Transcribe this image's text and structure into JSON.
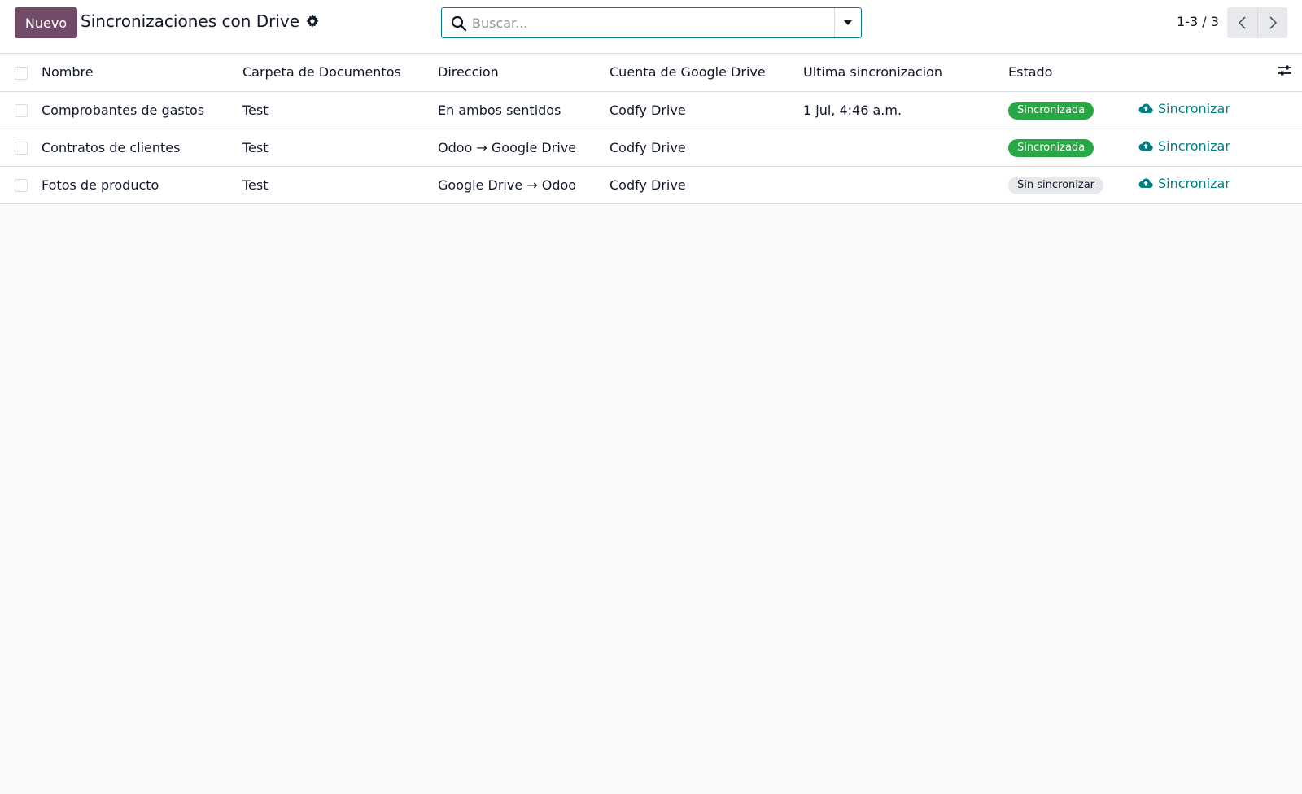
{
  "control_panel": {
    "new_button_label": "Nuevo",
    "title": "Sincronizaciones con Drive",
    "search_placeholder": "Buscar...",
    "pager_value": "1-3 / 3"
  },
  "table": {
    "columns": [
      "Nombre",
      "Carpeta de Documentos",
      "Direccion",
      "Cuenta de Google Drive",
      "Ultima sincronizacion",
      "Estado"
    ],
    "rows": [
      {
        "name": "Comprobantes de gastos",
        "folder": "Test",
        "direction": "En ambos sentidos",
        "account": "Codfy Drive",
        "last_sync": "1 jul, 4:46 a.m.",
        "status": "Sincronizada",
        "action": "Sincronizar"
      },
      {
        "name": "Contratos de clientes",
        "folder": "Test",
        "direction": "Odoo → Google Drive",
        "account": "Codfy Drive",
        "last_sync": "",
        "status": "Sincronizada",
        "action": "Sincronizar"
      },
      {
        "name": "Fotos de producto",
        "folder": "Test",
        "direction": "Google Drive → Odoo",
        "account": "Codfy Drive",
        "last_sync": "",
        "status": "Sin sincronizar",
        "action": "Sincronizar"
      }
    ]
  },
  "colors": {
    "primary": "#714b67",
    "link": "#017e84",
    "status_synced": "#28a745",
    "status_pending": "#e7e9ed"
  },
  "icons": {
    "settings": "gear-icon",
    "search": "search-icon",
    "search_options": "caret-down-icon",
    "pager_prev": "chevron-left-icon",
    "pager_next": "chevron-right-icon",
    "optional_columns": "sliders-icon",
    "sync": "cloud-upload-icon"
  }
}
